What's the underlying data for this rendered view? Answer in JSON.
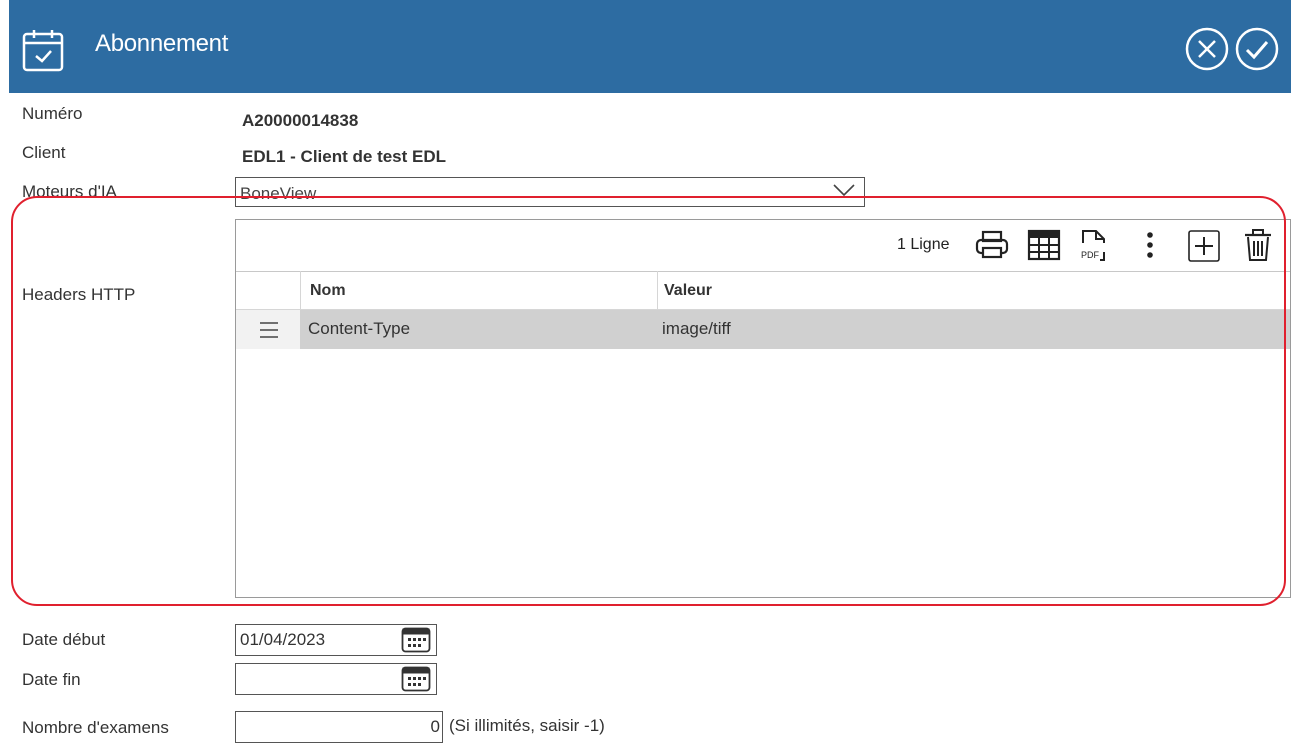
{
  "header": {
    "title": "Abonnement",
    "icon": "calendar-check-icon",
    "cancel_icon": "circle-x-icon",
    "confirm_icon": "circle-check-icon"
  },
  "fields": {
    "numero": {
      "label": "Numéro",
      "value": "A20000014838"
    },
    "client": {
      "label": "Client",
      "value": "EDL1 - Client de test EDL"
    },
    "moteurs": {
      "label": "Moteurs d'IA",
      "value": "BoneView"
    },
    "headers": {
      "label": "Headers HTTP"
    },
    "date_debut": {
      "label": "Date début",
      "value": "01/04/2023"
    },
    "date_fin": {
      "label": "Date fin",
      "value": ""
    },
    "nombre": {
      "label": "Nombre d'examens",
      "value": "0",
      "hint": "(Si illimités, saisir -1)"
    }
  },
  "grid": {
    "count": "1 Ligne",
    "toolbar_icons": [
      "printer-icon",
      "table-icon",
      "pdf-icon",
      "more-vertical-icon",
      "add-icon",
      "trash-icon"
    ],
    "columns": [
      "Nom",
      "Valeur"
    ],
    "rows": [
      {
        "nom": "Content-Type",
        "valeur": "image/tiff"
      }
    ]
  },
  "colors": {
    "header_bg": "#2d6ca2",
    "highlight_border": "#e0202e",
    "selected_row": "#d0d0d0"
  }
}
